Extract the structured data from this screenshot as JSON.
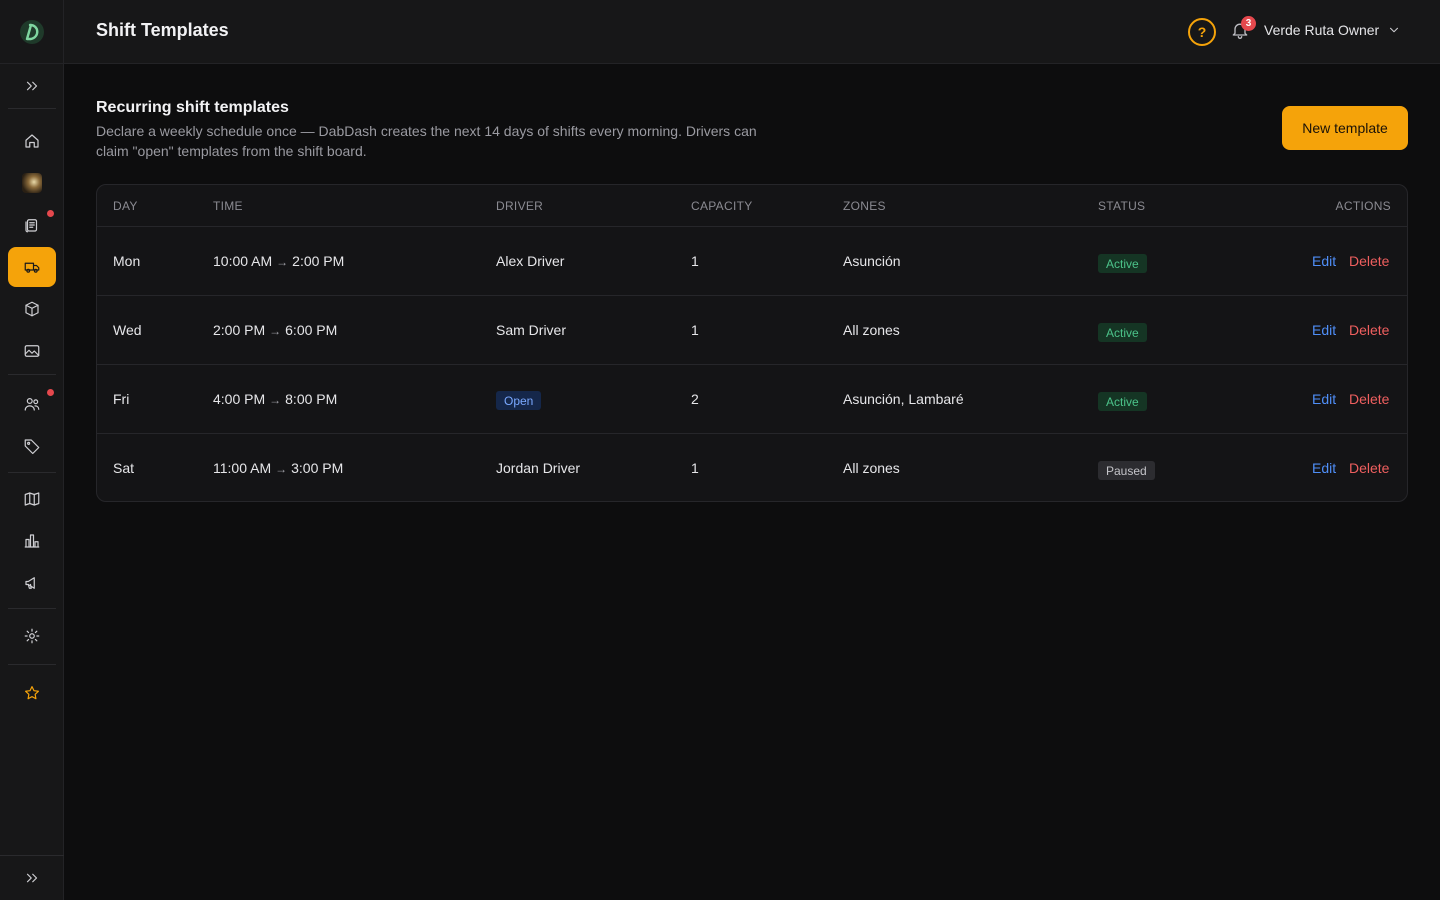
{
  "topbar": {
    "title": "Shift Templates",
    "help_symbol": "?",
    "notification_count": "3",
    "user_name": "Verde Ruta Owner"
  },
  "sidebar": {
    "items": [
      {
        "icon": "home-icon"
      },
      {
        "icon": "store-avatar-icon"
      },
      {
        "icon": "orders-icon",
        "dot": true
      },
      {
        "icon": "delivery-truck-icon",
        "active": true
      },
      {
        "icon": "package-icon"
      },
      {
        "icon": "image-icon"
      },
      {
        "icon": "users-icon",
        "dot": true
      },
      {
        "icon": "tag-icon"
      },
      {
        "icon": "map-icon"
      },
      {
        "icon": "analytics-icon"
      },
      {
        "icon": "megaphone-icon"
      },
      {
        "icon": "settings-icon"
      },
      {
        "icon": "star-icon"
      }
    ]
  },
  "header": {
    "title": "Recurring shift templates",
    "description": "Declare a weekly schedule once — DabDash creates the next 14 days of shifts every morning. Drivers can claim \"open\" templates from the shift board.",
    "new_button_label": "New template"
  },
  "table": {
    "columns": {
      "day": "DAY",
      "time": "TIME",
      "driver": "DRIVER",
      "capacity": "CAPACITY",
      "zones": "ZONES",
      "status": "STATUS",
      "actions": "ACTIONS"
    },
    "rows": [
      {
        "day": "Mon",
        "start": "10:00 AM",
        "end": "2:00 PM",
        "driver": "Alex Driver",
        "capacity": "1",
        "zones": "Asunción",
        "status": "Active",
        "edit": "Edit",
        "delete": "Delete"
      },
      {
        "day": "Wed",
        "start": "2:00 PM",
        "end": "6:00 PM",
        "driver": "Sam Driver",
        "capacity": "1",
        "zones": "All zones",
        "status": "Active",
        "edit": "Edit",
        "delete": "Delete"
      },
      {
        "day": "Fri",
        "start": "4:00 PM",
        "end": "8:00 PM",
        "driver": "Open",
        "capacity": "2",
        "zones": "Asunción, Lambaré",
        "status": "Active",
        "edit": "Edit",
        "delete": "Delete"
      },
      {
        "day": "Sat",
        "start": "11:00 AM",
        "end": "3:00 PM",
        "driver": "Jordan Driver",
        "capacity": "1",
        "zones": "All zones",
        "status": "Paused",
        "edit": "Edit",
        "delete": "Delete"
      }
    ],
    "arrow": "→"
  },
  "colors": {
    "accent": "#f5a30a",
    "link": "#4f8ef7",
    "danger": "#ef5f5f",
    "status_active": "#4cc38a"
  }
}
